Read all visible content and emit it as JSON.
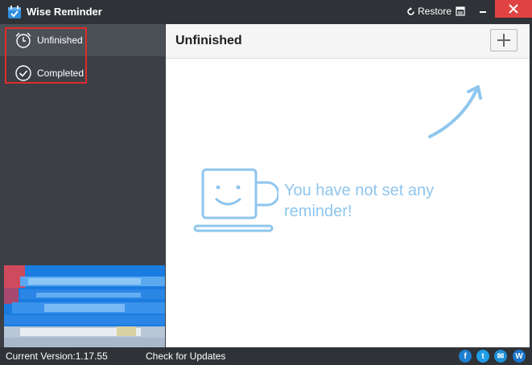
{
  "window": {
    "title": "Wise Reminder",
    "restore_label": "Restore"
  },
  "sidebar": {
    "items": [
      {
        "label": "Unfinished",
        "icon": "alarm-clock-icon",
        "active": true
      },
      {
        "label": "Completed",
        "icon": "check-circle-icon",
        "active": false
      }
    ]
  },
  "main": {
    "title": "Unfinished",
    "add_icon": "plus-icon",
    "empty_message": "You have not set any reminder!"
  },
  "footer": {
    "version": "Current Version:1.17.55",
    "check_updates": "Check for Updates",
    "social": [
      {
        "icon": "facebook-icon",
        "glyph": "f",
        "color": "#1f7fd0"
      },
      {
        "icon": "twitter-icon",
        "glyph": "t",
        "color": "#1f9ee8"
      },
      {
        "icon": "email-icon",
        "glyph": "✉",
        "color": "#1e8fd8"
      },
      {
        "icon": "wisecleaner-icon",
        "glyph": "W",
        "color": "#1a75c9"
      }
    ]
  },
  "colors": {
    "accent": "#8fc6ee",
    "close": "#e04343",
    "highlight": "#e02b2b"
  }
}
